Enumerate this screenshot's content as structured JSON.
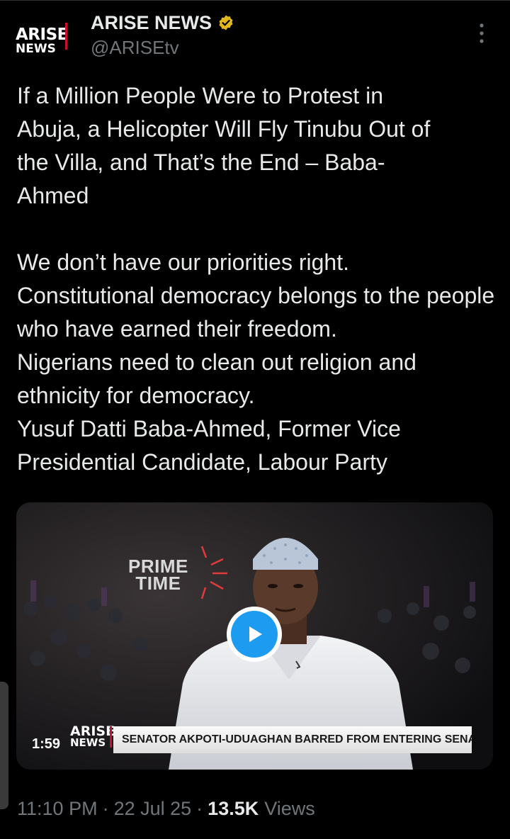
{
  "account": {
    "display_name": "ARISE NEWS",
    "handle": "@ARISEtv",
    "avatar_line1": "ARISE",
    "avatar_line2": "NEWS",
    "verified_color": "#e2b719"
  },
  "tweet": {
    "headline": "If a Million People Were to Protest in Abuja, a Helicopter Will Fly Tinubu Out of the Villa, and That’s the End – Baba-Ahmed",
    "body_lines": [
      "We don’t have our priorities right.",
      "Constitutional democracy belongs to the people who have earned their freedom.",
      "Nigerians need to clean out religion and ethnicity for democracy.",
      "Yusuf Datti Baba-Ahmed, Former Vice Presidential Candidate, Labour Party"
    ]
  },
  "video": {
    "show_logo_line1": "PRIME",
    "show_logo_line2": "TIME",
    "channel_line1": "ARISE",
    "channel_line2": "NEWS",
    "ticker": "SENATOR AKPOTI-UDUAGHAN BARRED FROM ENTERING SENATE",
    "duration": "1:59",
    "play_icon": "play-icon",
    "accent_color": "#1d9bf0"
  },
  "meta": {
    "time": "11:10 PM",
    "separator": "·",
    "date": "22 Jul 25",
    "views_count": "13.5K",
    "views_label": "Views"
  }
}
